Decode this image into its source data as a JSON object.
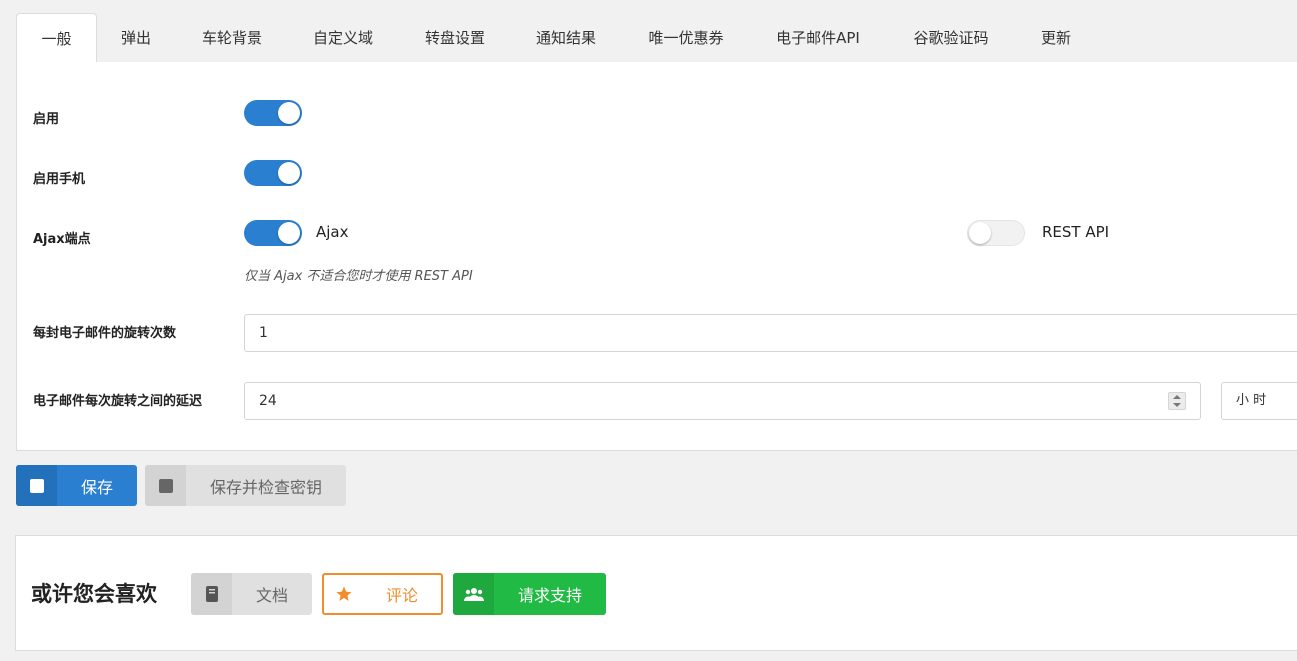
{
  "tabs": [
    {
      "label": "一般"
    },
    {
      "label": "弹出"
    },
    {
      "label": "车轮背景"
    },
    {
      "label": "自定义域"
    },
    {
      "label": "转盘设置"
    },
    {
      "label": "通知结果"
    },
    {
      "label": "唯一优惠券"
    },
    {
      "label": "电子邮件API"
    },
    {
      "label": "谷歌验证码"
    },
    {
      "label": "更新"
    }
  ],
  "settings": {
    "enable": {
      "label": "启用",
      "on": true
    },
    "enable_mobile": {
      "label": "启用手机",
      "on": true
    },
    "ajax_endpoint": {
      "label": "Ajax端点",
      "ajax_label": "Ajax",
      "ajax_on": true,
      "rest_label": "REST API",
      "rest_on": false,
      "hint": "仅当 Ajax 不适合您时才使用 REST API"
    },
    "spins_per_email": {
      "label": "每封电子邮件的旋转次数",
      "value": "1"
    },
    "delay": {
      "label": "电子邮件每次旋转之间的延迟",
      "value": "24",
      "unit": "小 时"
    }
  },
  "actions": {
    "save_label": "保存",
    "save_check_label": "保存并检查密钥"
  },
  "promo": {
    "title": "或许您会喜欢",
    "docs_label": "文档",
    "review_label": "评论",
    "support_label": "请求支持"
  },
  "colors": {
    "primary": "#2a7fd0",
    "review": "#f08d2d",
    "support": "#21ba45"
  }
}
